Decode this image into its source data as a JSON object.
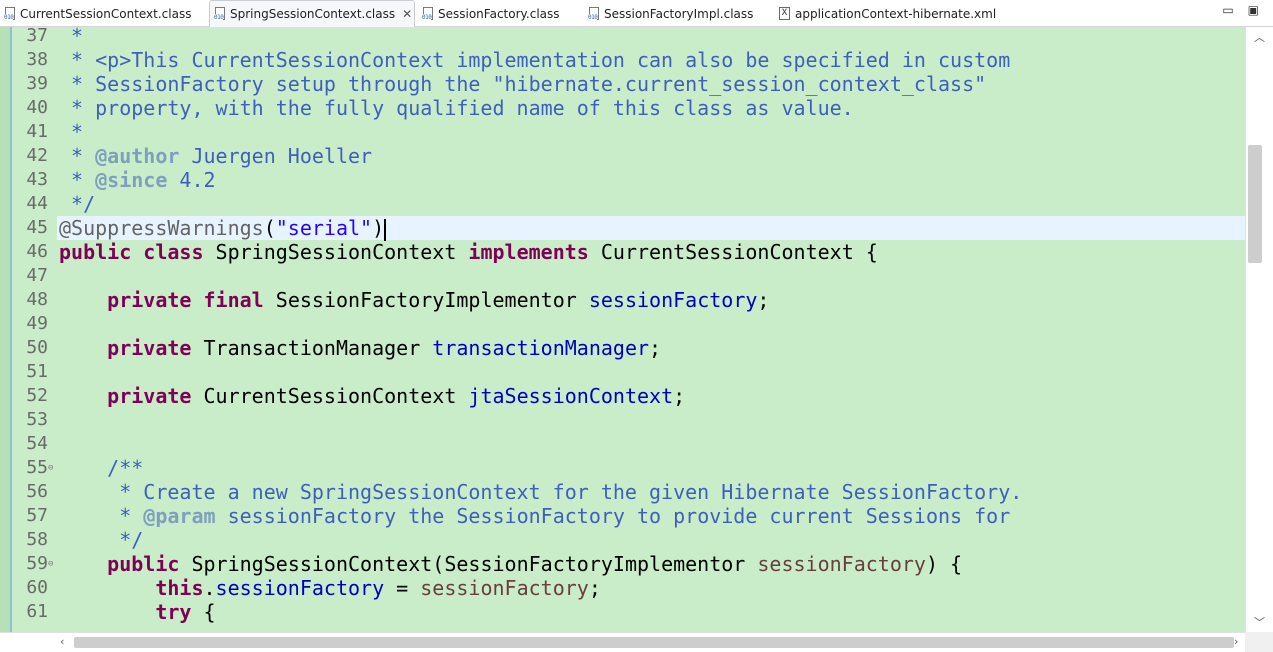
{
  "tabs": [
    {
      "label": "CurrentSessionContext.class",
      "type": "class",
      "active": false
    },
    {
      "label": "SpringSessionContext.class",
      "type": "class",
      "active": true,
      "closable": true
    },
    {
      "label": "SessionFactory.class",
      "type": "class",
      "active": false
    },
    {
      "label": "SessionFactoryImpl.class",
      "type": "class",
      "active": false
    },
    {
      "label": "applicationContext-hibernate.xml",
      "type": "xml",
      "active": false
    }
  ],
  "icons": {
    "class_file": "010",
    "xml_file": "X",
    "close": "✕",
    "minimize": "▭",
    "maximize": "▣"
  },
  "editor": {
    "background": "#c8edc8",
    "current_line_highlight": "#e7f3ff",
    "lines": [
      {
        "num": "37",
        "tokens": [
          {
            "t": " *",
            "c": "jd"
          }
        ]
      },
      {
        "num": "38",
        "tokens": [
          {
            "t": " * <p>This CurrentSessionContext implementation can also be specified in custom",
            "c": "jd"
          }
        ]
      },
      {
        "num": "39",
        "tokens": [
          {
            "t": " * SessionFactory setup through the \"hibernate.current_session_context_class\"",
            "c": "jd"
          }
        ]
      },
      {
        "num": "40",
        "tokens": [
          {
            "t": " * property, with the fully qualified name of this class as value.",
            "c": "jd"
          }
        ]
      },
      {
        "num": "41",
        "tokens": [
          {
            "t": " *",
            "c": "jd"
          }
        ]
      },
      {
        "num": "42",
        "tokens": [
          {
            "t": " * ",
            "c": "jd"
          },
          {
            "t": "@author",
            "c": "jdt"
          },
          {
            "t": " Juergen Hoeller",
            "c": "jd"
          }
        ]
      },
      {
        "num": "43",
        "tokens": [
          {
            "t": " * ",
            "c": "jd"
          },
          {
            "t": "@since",
            "c": "jdt"
          },
          {
            "t": " 4.2",
            "c": "jd"
          }
        ]
      },
      {
        "num": "44",
        "tokens": [
          {
            "t": " */",
            "c": "jd"
          }
        ]
      },
      {
        "num": "45",
        "current": true,
        "tokens": [
          {
            "t": "@SuppressWarnings",
            "c": "ann"
          },
          {
            "t": "(",
            "c": ""
          },
          {
            "t": "\"serial\"",
            "c": "str"
          },
          {
            "t": ")",
            "c": ""
          }
        ]
      },
      {
        "num": "46",
        "tokens": [
          {
            "t": "public",
            "c": "kw"
          },
          {
            "t": " ",
            "c": ""
          },
          {
            "t": "class",
            "c": "kw"
          },
          {
            "t": " SpringSessionContext ",
            "c": ""
          },
          {
            "t": "implements",
            "c": "kw"
          },
          {
            "t": " CurrentSessionContext {",
            "c": ""
          }
        ]
      },
      {
        "num": "47",
        "tokens": []
      },
      {
        "num": "48",
        "tokens": [
          {
            "t": "    ",
            "c": ""
          },
          {
            "t": "private",
            "c": "kw"
          },
          {
            "t": " ",
            "c": ""
          },
          {
            "t": "final",
            "c": "kw"
          },
          {
            "t": " SessionFactoryImplementor ",
            "c": ""
          },
          {
            "t": "sessionFactory",
            "c": "fld"
          },
          {
            "t": ";",
            "c": ""
          }
        ]
      },
      {
        "num": "49",
        "tokens": []
      },
      {
        "num": "50",
        "tokens": [
          {
            "t": "    ",
            "c": ""
          },
          {
            "t": "private",
            "c": "kw"
          },
          {
            "t": " TransactionManager ",
            "c": ""
          },
          {
            "t": "transactionManager",
            "c": "fld"
          },
          {
            "t": ";",
            "c": ""
          }
        ]
      },
      {
        "num": "51",
        "tokens": []
      },
      {
        "num": "52",
        "tokens": [
          {
            "t": "    ",
            "c": ""
          },
          {
            "t": "private",
            "c": "kw"
          },
          {
            "t": " CurrentSessionContext ",
            "c": ""
          },
          {
            "t": "jtaSessionContext",
            "c": "fld"
          },
          {
            "t": ";",
            "c": ""
          }
        ]
      },
      {
        "num": "53",
        "tokens": []
      },
      {
        "num": "54",
        "tokens": []
      },
      {
        "num": "55",
        "fold": true,
        "tokens": [
          {
            "t": "    /**",
            "c": "jd"
          }
        ]
      },
      {
        "num": "56",
        "tokens": [
          {
            "t": "     * Create a new SpringSessionContext for the given Hibernate SessionFactory.",
            "c": "jd"
          }
        ]
      },
      {
        "num": "57",
        "tokens": [
          {
            "t": "     * ",
            "c": "jd"
          },
          {
            "t": "@param",
            "c": "jdt"
          },
          {
            "t": " sessionFactory the SessionFactory to provide current Sessions for",
            "c": "jd"
          }
        ]
      },
      {
        "num": "58",
        "tokens": [
          {
            "t": "     */",
            "c": "jd"
          }
        ]
      },
      {
        "num": "59",
        "fold": true,
        "tokens": [
          {
            "t": "    ",
            "c": ""
          },
          {
            "t": "public",
            "c": "kw"
          },
          {
            "t": " SpringSessionContext(SessionFactoryImplementor ",
            "c": ""
          },
          {
            "t": "sessionFactory",
            "c": "prm"
          },
          {
            "t": ") {",
            "c": ""
          }
        ]
      },
      {
        "num": "60",
        "tokens": [
          {
            "t": "        ",
            "c": ""
          },
          {
            "t": "this",
            "c": "kw"
          },
          {
            "t": ".",
            "c": ""
          },
          {
            "t": "sessionFactory",
            "c": "fld"
          },
          {
            "t": " = ",
            "c": ""
          },
          {
            "t": "sessionFactory",
            "c": "prm"
          },
          {
            "t": ";",
            "c": ""
          }
        ]
      },
      {
        "num": "61",
        "tokens": [
          {
            "t": "        ",
            "c": ""
          },
          {
            "t": "try",
            "c": "kw"
          },
          {
            "t": " {",
            "c": ""
          }
        ]
      }
    ]
  }
}
